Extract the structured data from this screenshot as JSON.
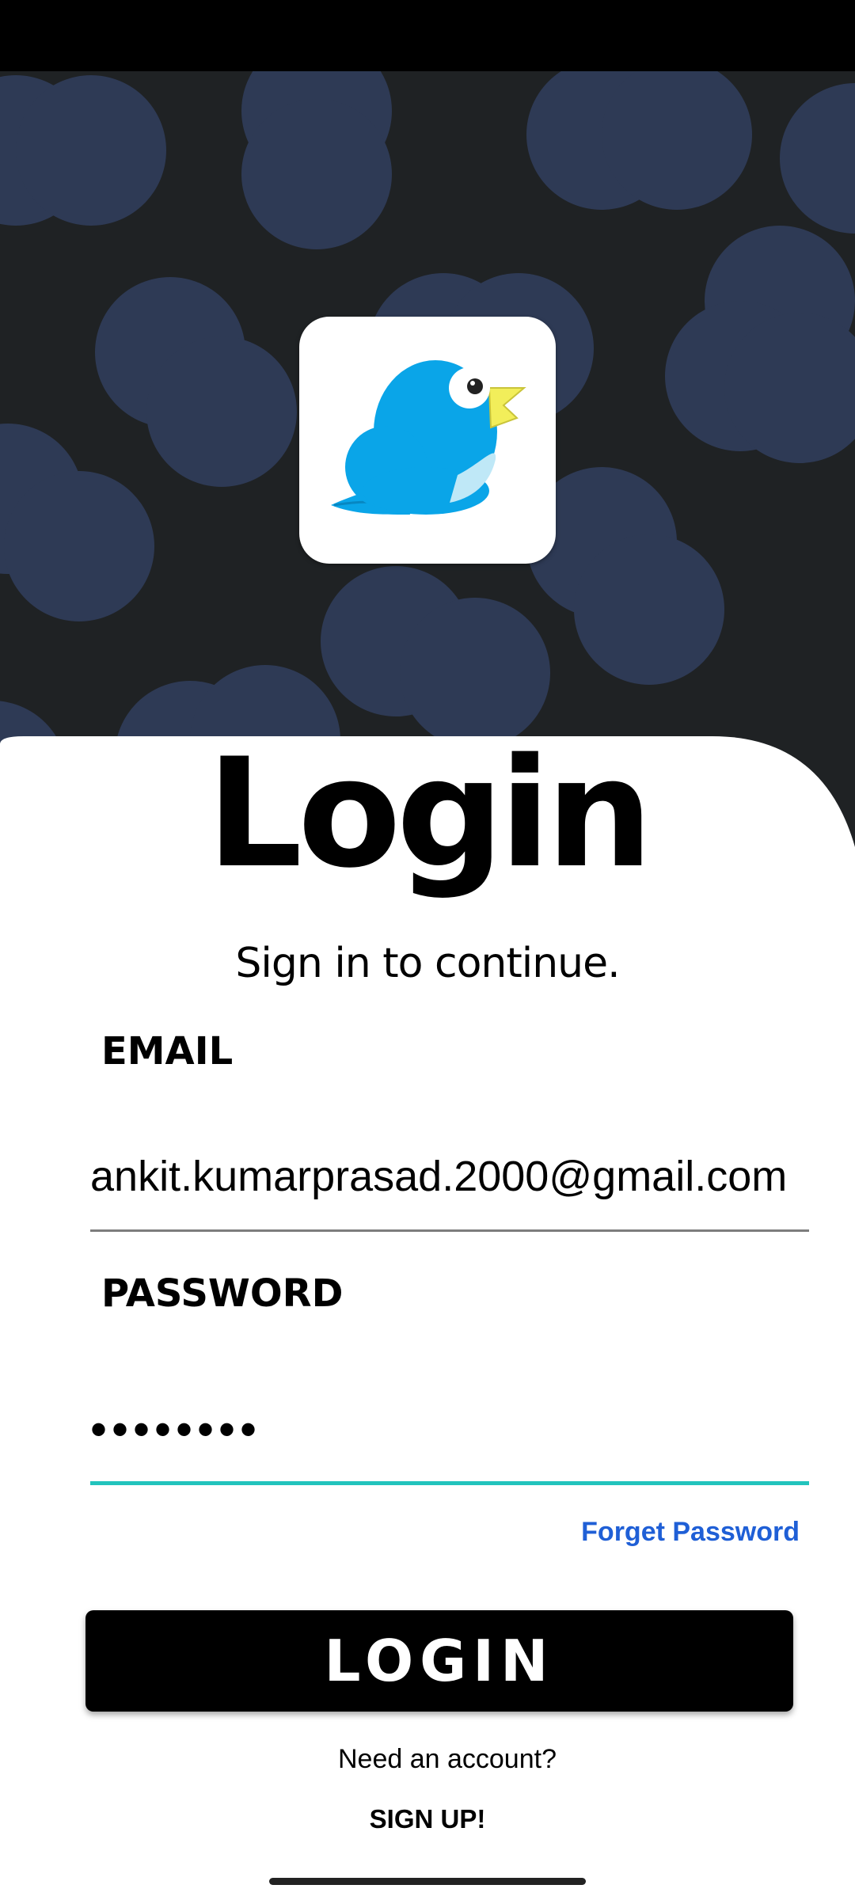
{
  "app": {
    "title": "Login",
    "subtitle": "Sign in to continue.",
    "logo_icon": "bird-logo-icon"
  },
  "form": {
    "email_label": "EMAIL",
    "email_value": "ankit.kumarprasad.2000@gmail.com",
    "password_label": "PASSWORD",
    "password_value": "••••••••",
    "forgot_label": "Forget Password",
    "login_label": "LOGIN"
  },
  "footer": {
    "need_account": "Need an account?",
    "signup_label": "SIGN UP!"
  },
  "colors": {
    "hero_background": "#1f2224",
    "hero_circles": "#2e3a55",
    "focus_underline": "#22c4bd",
    "link": "#1f5fd6",
    "bird": "#0aa5e8",
    "beak": "#f2ee5a"
  }
}
